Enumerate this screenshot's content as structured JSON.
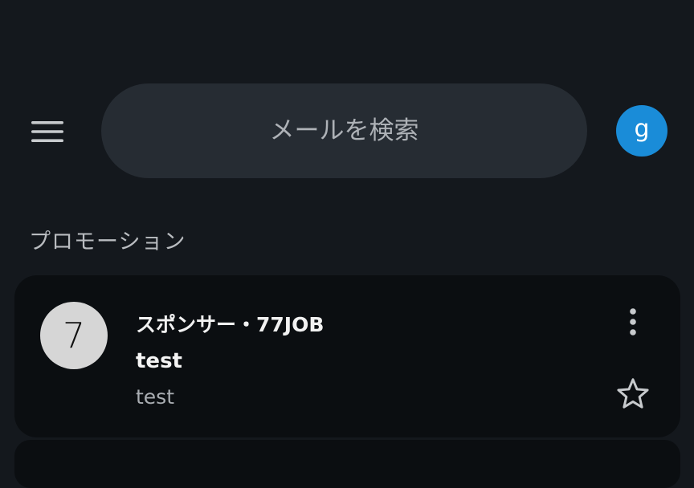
{
  "search": {
    "placeholder": "メールを検索"
  },
  "account": {
    "avatar_letter": "g",
    "avatar_color": "#1a8cd8"
  },
  "section": {
    "title": "プロモーション"
  },
  "messages": [
    {
      "avatar_letter": "7",
      "sender": "スポンサー・77JOB",
      "subject": "test",
      "snippet": "test",
      "starred": false,
      "icons": [
        "more-vert-icon",
        "star-outline-icon"
      ]
    }
  ],
  "colors": {
    "background": "#14181d",
    "search_bg": "#262c33",
    "card_bg": "#0b0e11",
    "sender_avatar_bg": "#d6d6d6"
  }
}
